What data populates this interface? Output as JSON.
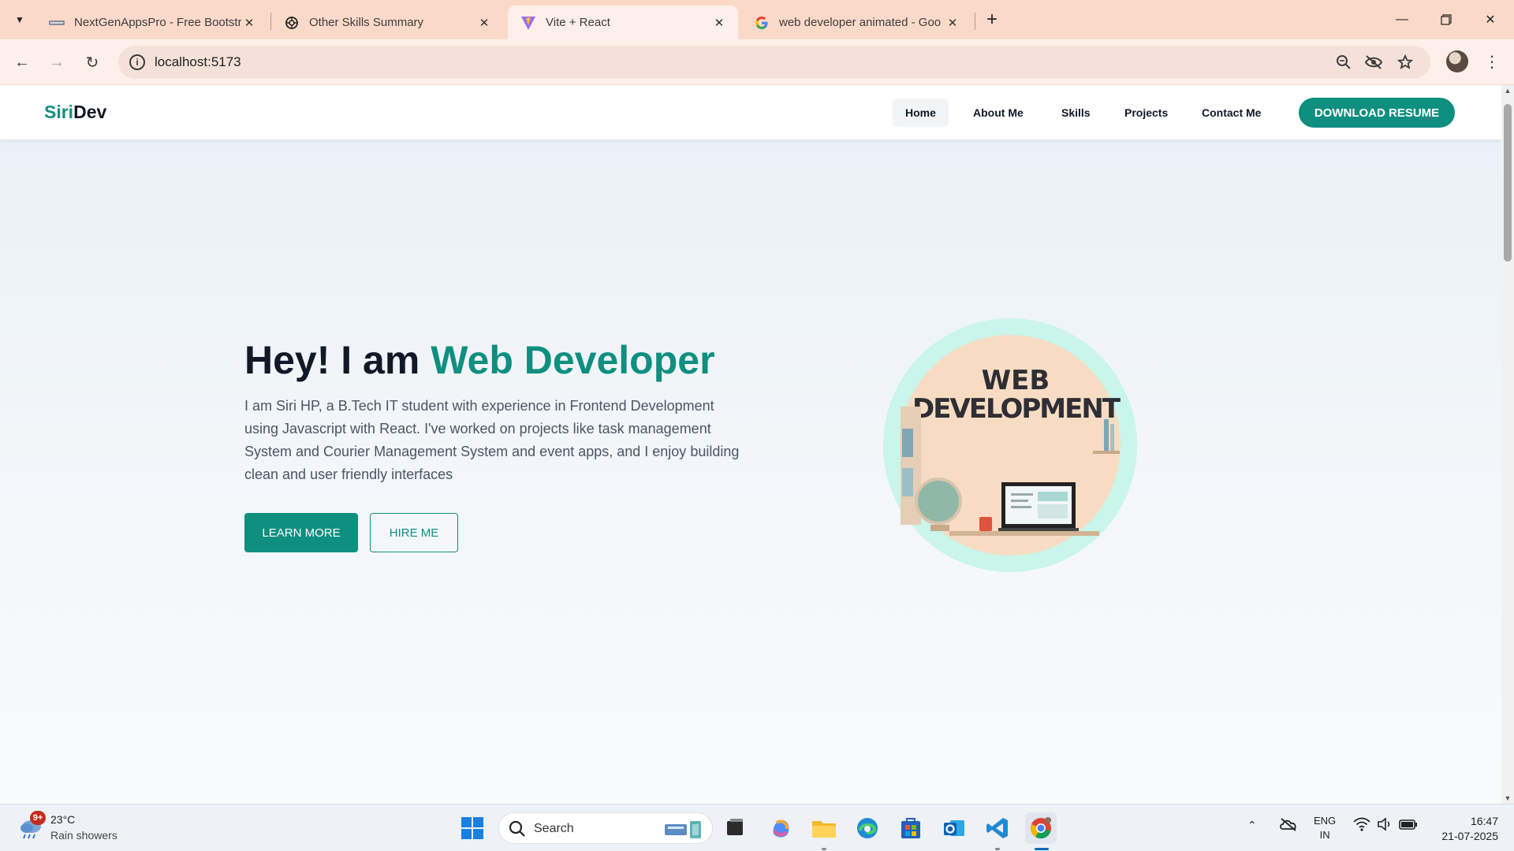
{
  "browser": {
    "tabs": [
      {
        "title": "NextGenAppsPro - Free Bootstr",
        "active": false
      },
      {
        "title": "Other Skills Summary",
        "active": false
      },
      {
        "title": "Vite + React",
        "active": true
      },
      {
        "title": "web developer animated - Goo",
        "active": false
      }
    ],
    "new_tab_label": "+",
    "url": "localhost:5173"
  },
  "site": {
    "logo_primary": "Siri",
    "logo_secondary": "Dev",
    "nav": [
      {
        "label": "Home",
        "active": true
      },
      {
        "label": "About Me",
        "active": false
      },
      {
        "label": "Skills",
        "active": false
      },
      {
        "label": "Projects",
        "active": false
      },
      {
        "label": "Contact Me",
        "active": false
      }
    ],
    "resume_button": "DOWNLOAD RESUME",
    "accent_color": "#0f8f80"
  },
  "hero": {
    "title_prefix": "Hey! I am ",
    "title_accent": "Web Developer",
    "description": "I am Siri HP, a B.Tech IT student with experience in Frontend Development using Javascript with React. I've worked on projects like task management System and Courier Management System and event apps, and I enjoy building clean and user friendly interfaces",
    "learn_more": "LEARN MORE",
    "hire_me": "HIRE ME",
    "illustration_line1": "WEB",
    "illustration_line2": "DEVELOPMENT"
  },
  "taskbar": {
    "weather_badge": "9+",
    "weather_temp": "23°C",
    "weather_desc": "Rain showers",
    "search_label": "Search",
    "lang_line1": "ENG",
    "lang_line2": "IN",
    "time": "16:47",
    "date": "21-07-2025"
  }
}
